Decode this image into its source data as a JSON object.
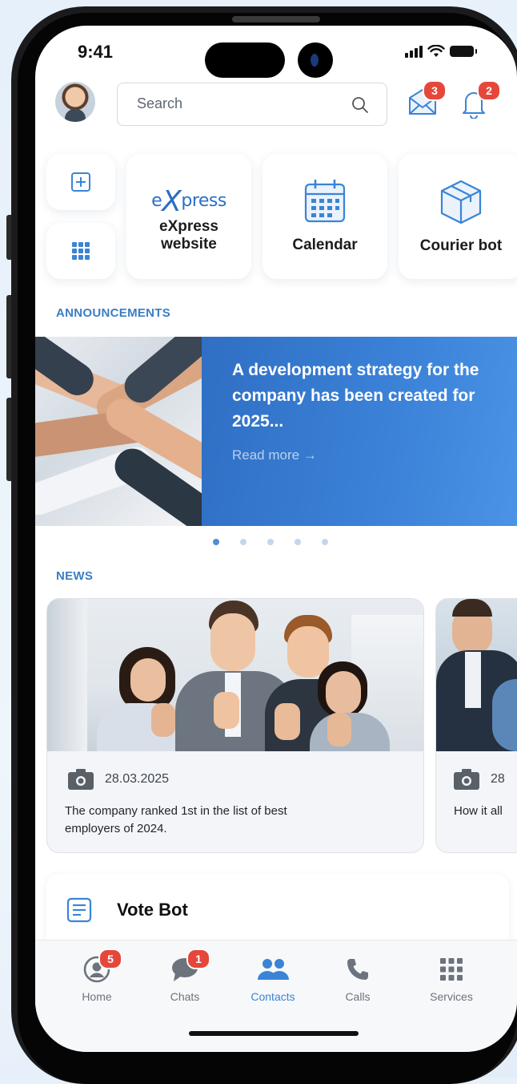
{
  "status_bar": {
    "time": "9:41"
  },
  "header": {
    "search_placeholder": "Search",
    "mail_badge": "3",
    "bell_badge": "2"
  },
  "shortcuts": [
    {
      "label": "eXpress website",
      "logo_text": "press",
      "logo_prefix": "e",
      "logo_x": "X"
    },
    {
      "label": "Calendar"
    },
    {
      "label": "Courier bot"
    }
  ],
  "announcements": {
    "title": "ANNOUNCEMENTS",
    "headline": "A development strategy for the company has been created for 2025...",
    "read_more": "Read more  →",
    "dots": 5,
    "active_dot": 0
  },
  "news": {
    "title": "NEWS",
    "items": [
      {
        "date": "28.03.2025",
        "text": "The company ranked 1st in the list of best employers of 2024."
      },
      {
        "date": "28",
        "text": "How it all"
      }
    ]
  },
  "vote_bot": {
    "label": "Vote Bot"
  },
  "tabbar": {
    "tabs": [
      {
        "label": "Home",
        "badge": "5"
      },
      {
        "label": "Chats",
        "badge": "1"
      },
      {
        "label": "Contacts",
        "active": true
      },
      {
        "label": "Calls"
      },
      {
        "label": "Services"
      }
    ]
  },
  "colors": {
    "accent": "#3a84d6",
    "badge": "#e5483a",
    "banner": "#3b82d8",
    "section_title": "#3a7ec4"
  }
}
